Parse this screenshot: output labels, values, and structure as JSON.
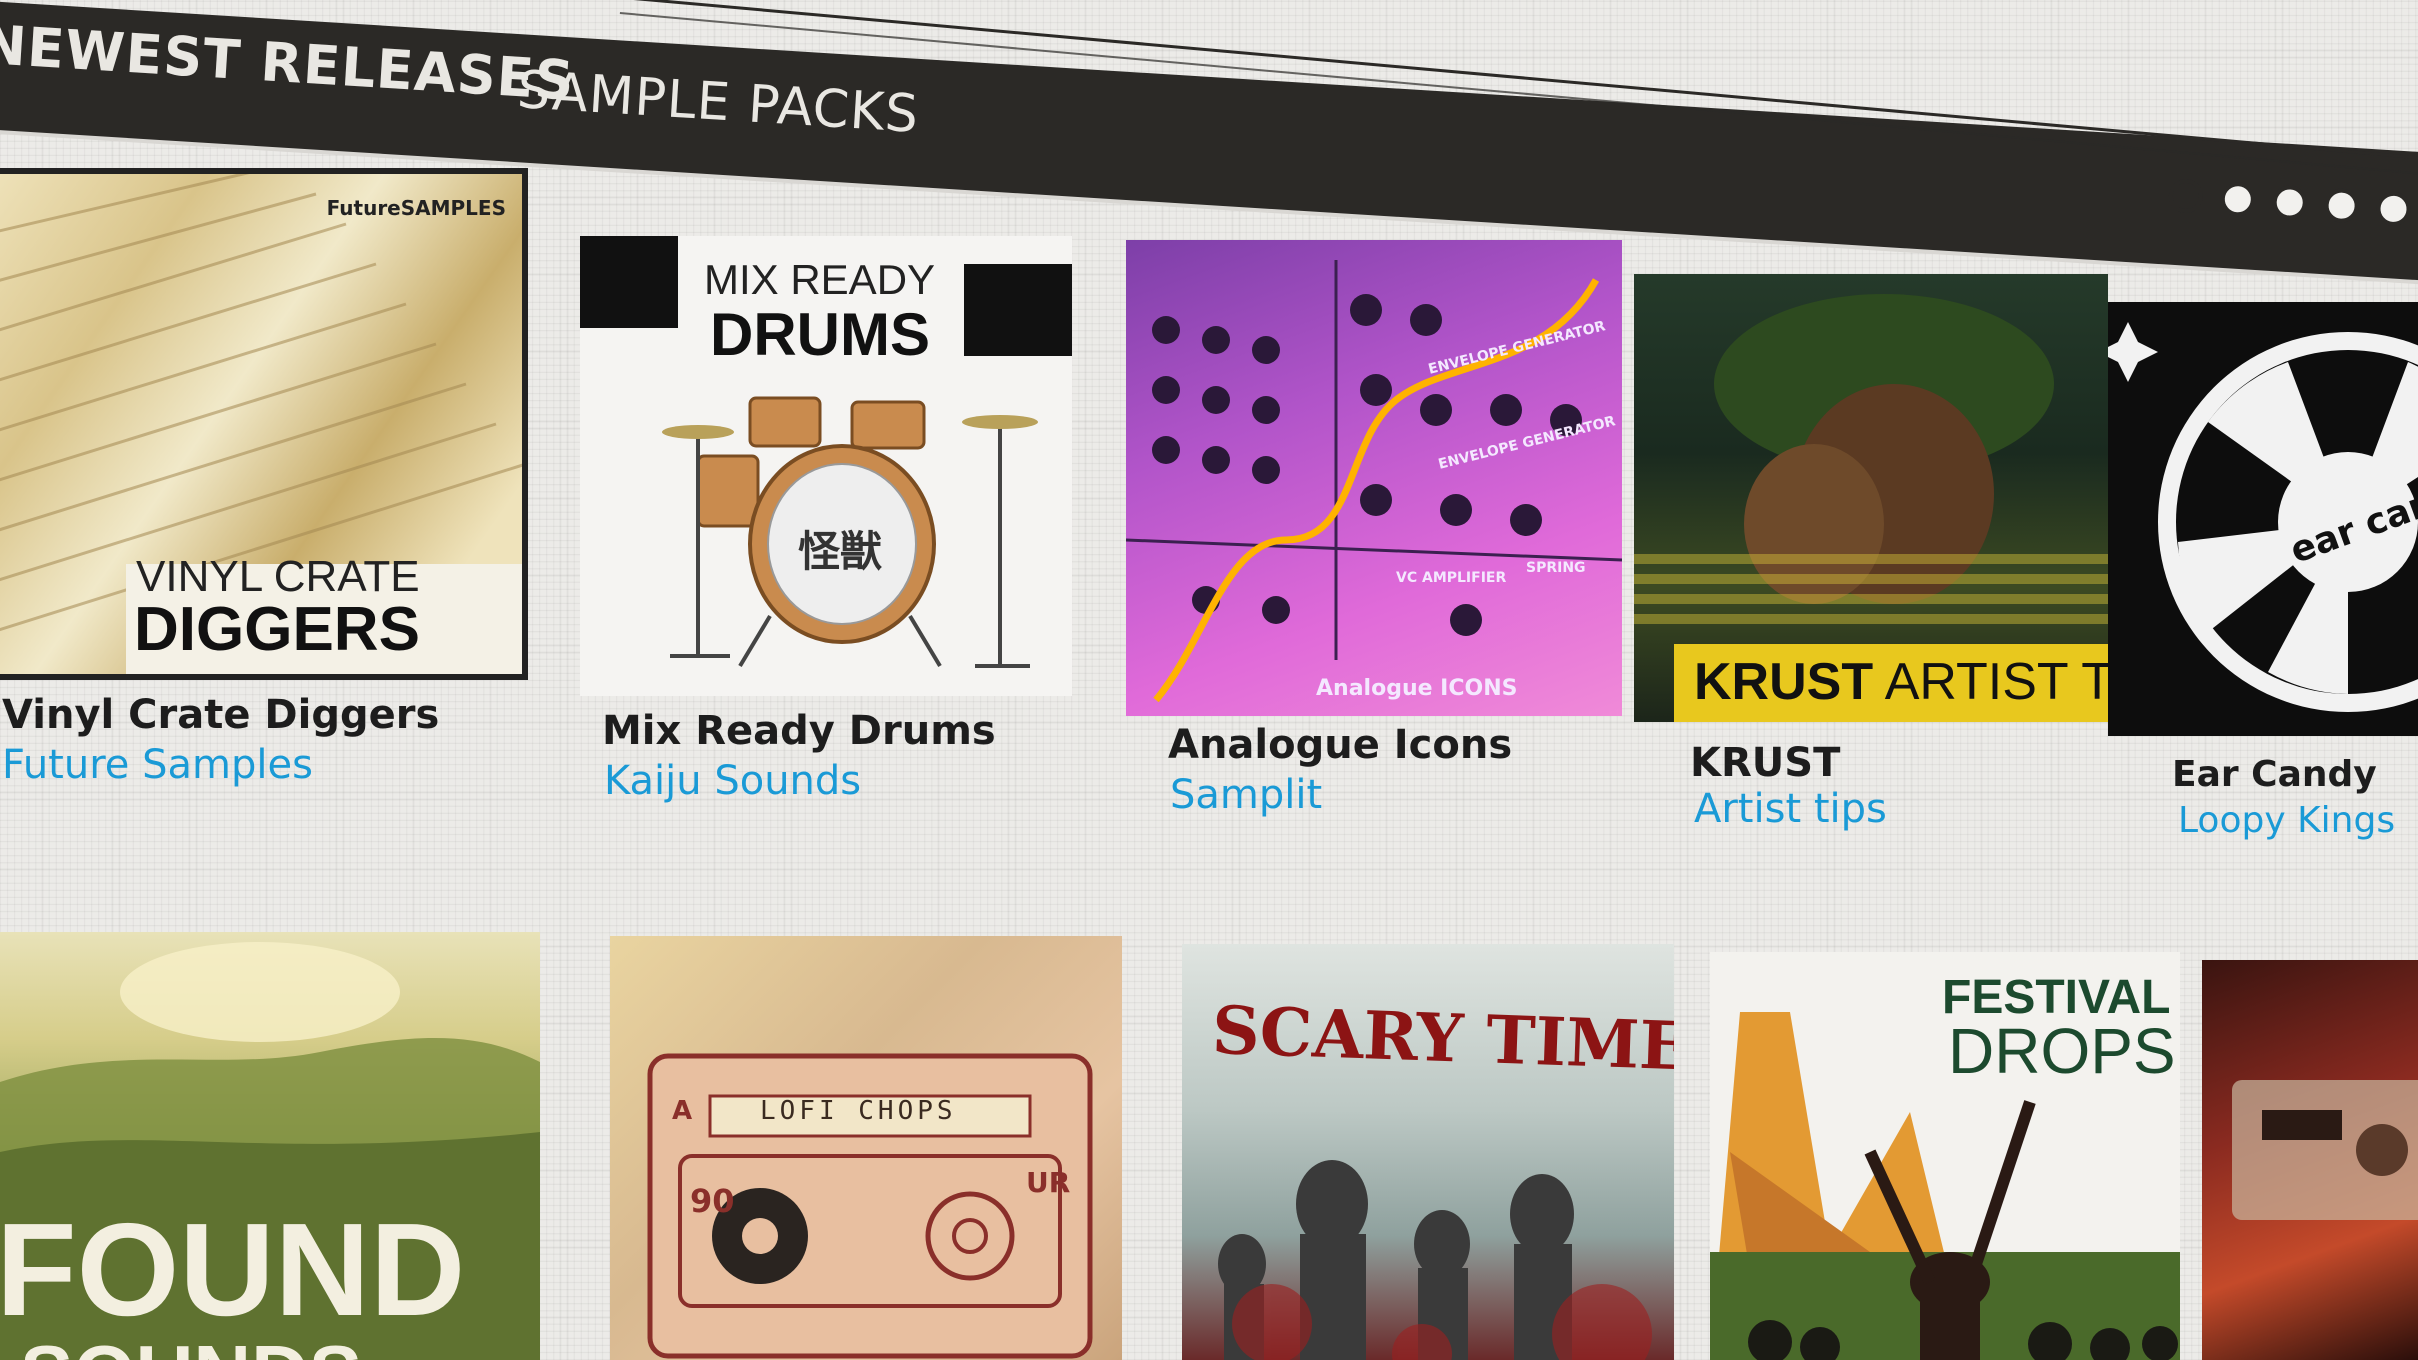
{
  "header": {
    "title": "NEWEST RELEASES",
    "subtitle": "SAMPLE PACKS"
  },
  "pager": {
    "count": 5,
    "active": 1
  },
  "row1": [
    {
      "title": "Vinyl Crate Diggers",
      "label": "Future Samples",
      "cover_brand": "FutureSAMPLES",
      "cover_line1": "VINYL CRATE",
      "cover_line2": "DIGGERS"
    },
    {
      "title": "Mix Ready Drums",
      "label": "Kaiju Sounds",
      "cover_line1": "MIX READY",
      "cover_line2": "DRUMS",
      "drum_glyph": "怪獣"
    },
    {
      "title": "Analogue Icons",
      "label": "Samplit",
      "cover_caption": "Analogue ICONS",
      "panel_labels": [
        "ENVELOPE GENERATOR",
        "ENVELOPE GENERATOR",
        "VC AMPLIFIER",
        "SPRING"
      ]
    },
    {
      "title": "KRUST",
      "label": "Artist tips",
      "cover_bold": "KRUST",
      "cover_rest": "ARTIST TIPS"
    },
    {
      "title": "Ear Candy",
      "label": "Loopy Kings",
      "cover_text": "ear candy"
    }
  ],
  "row2": [
    {
      "cover_text": "FOUND",
      "cover_text2": "SOUNDS"
    },
    {
      "cover_text": "LOFI CHOPS",
      "tape_side": "A",
      "tape_len": "90",
      "tape_brand": "UR"
    },
    {
      "cover_text": "SCARY TIMES"
    },
    {
      "cover_line1": "FESTIVAL",
      "cover_line2": "DROPS"
    },
    {
      "cover_text": ""
    }
  ],
  "colors": {
    "accent": "#1a9ad6",
    "header_bg": "#2b2926"
  }
}
